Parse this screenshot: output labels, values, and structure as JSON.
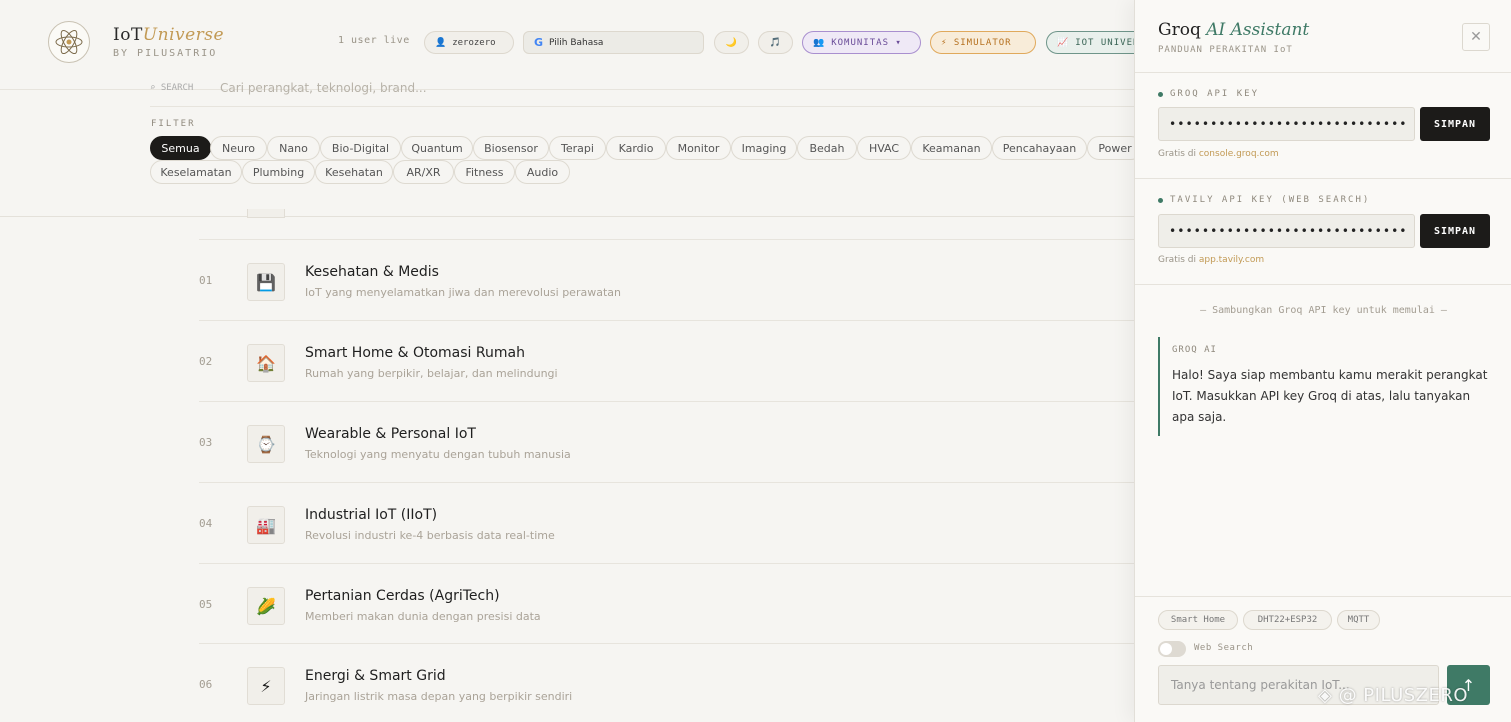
{
  "header": {
    "brand_main": "IoT",
    "brand_em": "Universe",
    "brand_sub": "BY PILUSATRIO",
    "live_text": "1 user live",
    "user_name": "zerozero",
    "lang_label": "Pilih Bahasa",
    "moon": "🌙",
    "music": "🎵",
    "komunitas": "KOMUNITAS ▾",
    "simulator": "⚡ SIMULATOR",
    "iot_universe": "IOT UNIVERSE"
  },
  "search": {
    "icon_text": "⌕ SEARCH",
    "placeholder": "Cari perangkat, teknologi, brand..."
  },
  "filter": {
    "label": "FILTER",
    "chips": [
      "Semua",
      "Neuro",
      "Nano",
      "Bio-Digital",
      "Quantum",
      "Biosensor",
      "Terapi",
      "Kardio",
      "Monitor",
      "Imaging",
      "Bedah",
      "HVAC",
      "Keamanan",
      "Pencahayaan",
      "Power",
      "Keselamatan",
      "Plumbing",
      "Kesehatan",
      "AR/XR",
      "Fitness",
      "Audio"
    ]
  },
  "categories": [
    {
      "num": "01",
      "icon": "💾",
      "title": "Kesehatan & Medis",
      "desc": "IoT yang menyelamatkan jiwa dan merevolusi perawatan"
    },
    {
      "num": "02",
      "icon": "🏠",
      "title": "Smart Home & Otomasi Rumah",
      "desc": "Rumah yang berpikir, belajar, dan melindungi"
    },
    {
      "num": "03",
      "icon": "⌚",
      "title": "Wearable & Personal IoT",
      "desc": "Teknologi yang menyatu dengan tubuh manusia"
    },
    {
      "num": "04",
      "icon": "🏭",
      "title": "Industrial IoT (IIoT)",
      "desc": "Revolusi industri ke-4 berbasis data real-time"
    },
    {
      "num": "05",
      "icon": "🌽",
      "title": "Pertanian Cerdas (AgriTech)",
      "desc": "Memberi makan dunia dengan presisi data"
    },
    {
      "num": "06",
      "icon": "⚡",
      "title": "Energi & Smart Grid",
      "desc": "Jaringan listrik masa depan yang berpikir sendiri"
    }
  ],
  "panel": {
    "title_main": "Groq ",
    "title_em": "AI Assistant",
    "subtitle": "PANDUAN PERAKITAN IoT",
    "close": "✕",
    "groq_label": "GROQ API KEY",
    "groq_value": "•••••••••••••••••••••••••••••",
    "save": "SIMPAN",
    "groq_note_prefix": "Gratis di ",
    "groq_note_link": "console.groq.com",
    "tavily_label": "TAVILY API KEY (WEB SEARCH)",
    "tavily_value": "•••••••••••••••••••••••••••••",
    "tavily_note_prefix": "Gratis di ",
    "tavily_note_link": "app.tavily.com",
    "connect_msg": "— Sambungkan Groq API key untuk memulai —",
    "ai_who": "GROQ AI",
    "ai_text": "Halo! Saya siap membantu kamu merakit perangkat IoT. Masukkan API key Groq di atas, lalu tanyakan apa saja.",
    "suggestions": [
      "Smart Home",
      "DHT22+ESP32",
      "MQTT"
    ],
    "web_search": "Web Search",
    "chat_placeholder": "Tanya tentang perakitan IoT...",
    "send": "↑"
  },
  "watermark": "◈ @ PILUSZERO"
}
